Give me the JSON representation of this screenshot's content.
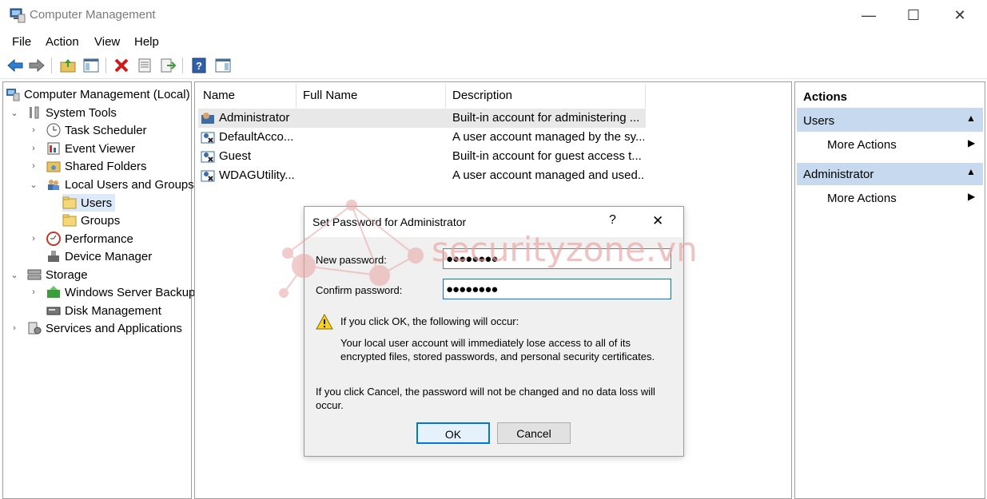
{
  "window": {
    "title": "Computer Management",
    "minimize_glyph": "—",
    "maximize_glyph": "☐",
    "close_glyph": "✕"
  },
  "menu": [
    "File",
    "Action",
    "View",
    "Help"
  ],
  "toolbar": {
    "icons": [
      "back-arrow-icon",
      "forward-arrow-icon",
      "up-folder-icon",
      "show-hide-tree-icon",
      "delete-icon",
      "properties-icon",
      "export-list-icon",
      "help-icon",
      "show-hide-action-pane-icon"
    ]
  },
  "tree": {
    "root": "Computer Management (Local)",
    "system_tools": "System Tools",
    "task_scheduler": "Task Scheduler",
    "event_viewer": "Event Viewer",
    "shared_folders": "Shared Folders",
    "local_users_groups": "Local Users and Groups",
    "users": "Users",
    "groups": "Groups",
    "performance": "Performance",
    "device_manager": "Device Manager",
    "storage": "Storage",
    "windows_server_backup": "Windows Server Backup",
    "disk_management": "Disk Management",
    "services_apps": "Services and Applications"
  },
  "list": {
    "columns": [
      "Name",
      "Full Name",
      "Description"
    ],
    "rows": [
      {
        "name": "Administrator",
        "full_name": "",
        "description": "Built-in account for administering ..."
      },
      {
        "name": "DefaultAcco...",
        "full_name": "",
        "description": "A user account managed by the sy..."
      },
      {
        "name": "Guest",
        "full_name": "",
        "description": "Built-in account for guest access t..."
      },
      {
        "name": "WDAGUtility...",
        "full_name": "",
        "description": "A user account managed and used..."
      }
    ]
  },
  "actions": {
    "header": "Actions",
    "section1": "Users",
    "section1_item": "More Actions",
    "section2": "Administrator",
    "section2_item": "More Actions"
  },
  "dialog": {
    "title": "Set Password for Administrator",
    "help_glyph": "?",
    "close_glyph": "✕",
    "new_password_label": "New password:",
    "new_password_value": "●●●●●●●●",
    "confirm_password_label": "Confirm password:",
    "confirm_password_value": "●●●●●●●●",
    "warning_intro": "If you click OK, the following will occur:",
    "warning_body": "Your local user account will immediately lose access to all of its encrypted files, stored passwords, and personal security certificates.",
    "cancel_note": "If you click Cancel, the password will not be changed and no data loss will occur.",
    "ok_label": "OK",
    "cancel_label": "Cancel"
  },
  "watermark": {
    "text": "securityzone.vn",
    "color": "#e9a3a3"
  },
  "colors": {
    "selection": "#dbe9f9",
    "actions_header": "#c7d9ef",
    "dialog_bg": "#f0f0f0",
    "ok_border": "#0078d7"
  }
}
